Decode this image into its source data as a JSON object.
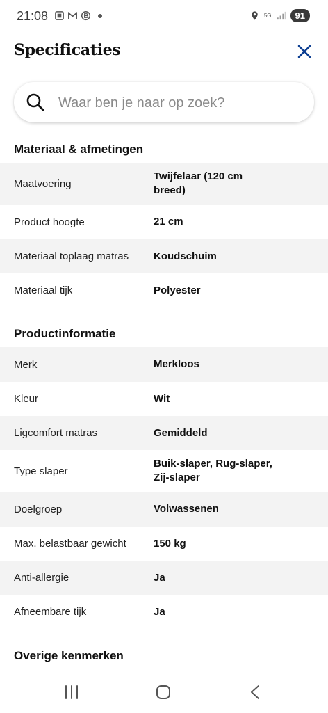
{
  "status": {
    "time": "21:08",
    "network": "5G",
    "battery": "91"
  },
  "header": {
    "title": "Specificaties",
    "close_icon": "close-icon",
    "accent_color": "#0b3d91"
  },
  "search": {
    "placeholder": "Waar ben je naar op zoek?"
  },
  "sections": [
    {
      "title": "Materiaal & afmetingen",
      "rows": [
        {
          "label": "Maatvoering",
          "value": "Twijfelaar (120 cm breed)"
        },
        {
          "label": "Product hoogte",
          "value": "21 cm"
        },
        {
          "label": "Materiaal toplaag matras",
          "value": "Koudschuim"
        },
        {
          "label": "Materiaal tijk",
          "value": "Polyester"
        }
      ]
    },
    {
      "title": "Productinformatie",
      "rows": [
        {
          "label": "Merk",
          "value": "Merkloos"
        },
        {
          "label": "Kleur",
          "value": "Wit"
        },
        {
          "label": "Ligcomfort matras",
          "value": "Gemiddeld"
        },
        {
          "label": "Type slaper",
          "value": "Buik-slaper, Rug-slaper, Zij-slaper"
        },
        {
          "label": "Doelgroep",
          "value": "Volwassenen"
        },
        {
          "label": "Max. belastbaar gewicht",
          "value": "150 kg"
        },
        {
          "label": "Anti-allergie",
          "value": "Ja"
        },
        {
          "label": "Afneembare tijk",
          "value": "Ja"
        }
      ]
    },
    {
      "title": "Overige kenmerken",
      "rows": []
    }
  ],
  "navbar": {
    "recents_icon": "recents-icon",
    "home_icon": "home-icon",
    "back_icon": "back-icon"
  }
}
